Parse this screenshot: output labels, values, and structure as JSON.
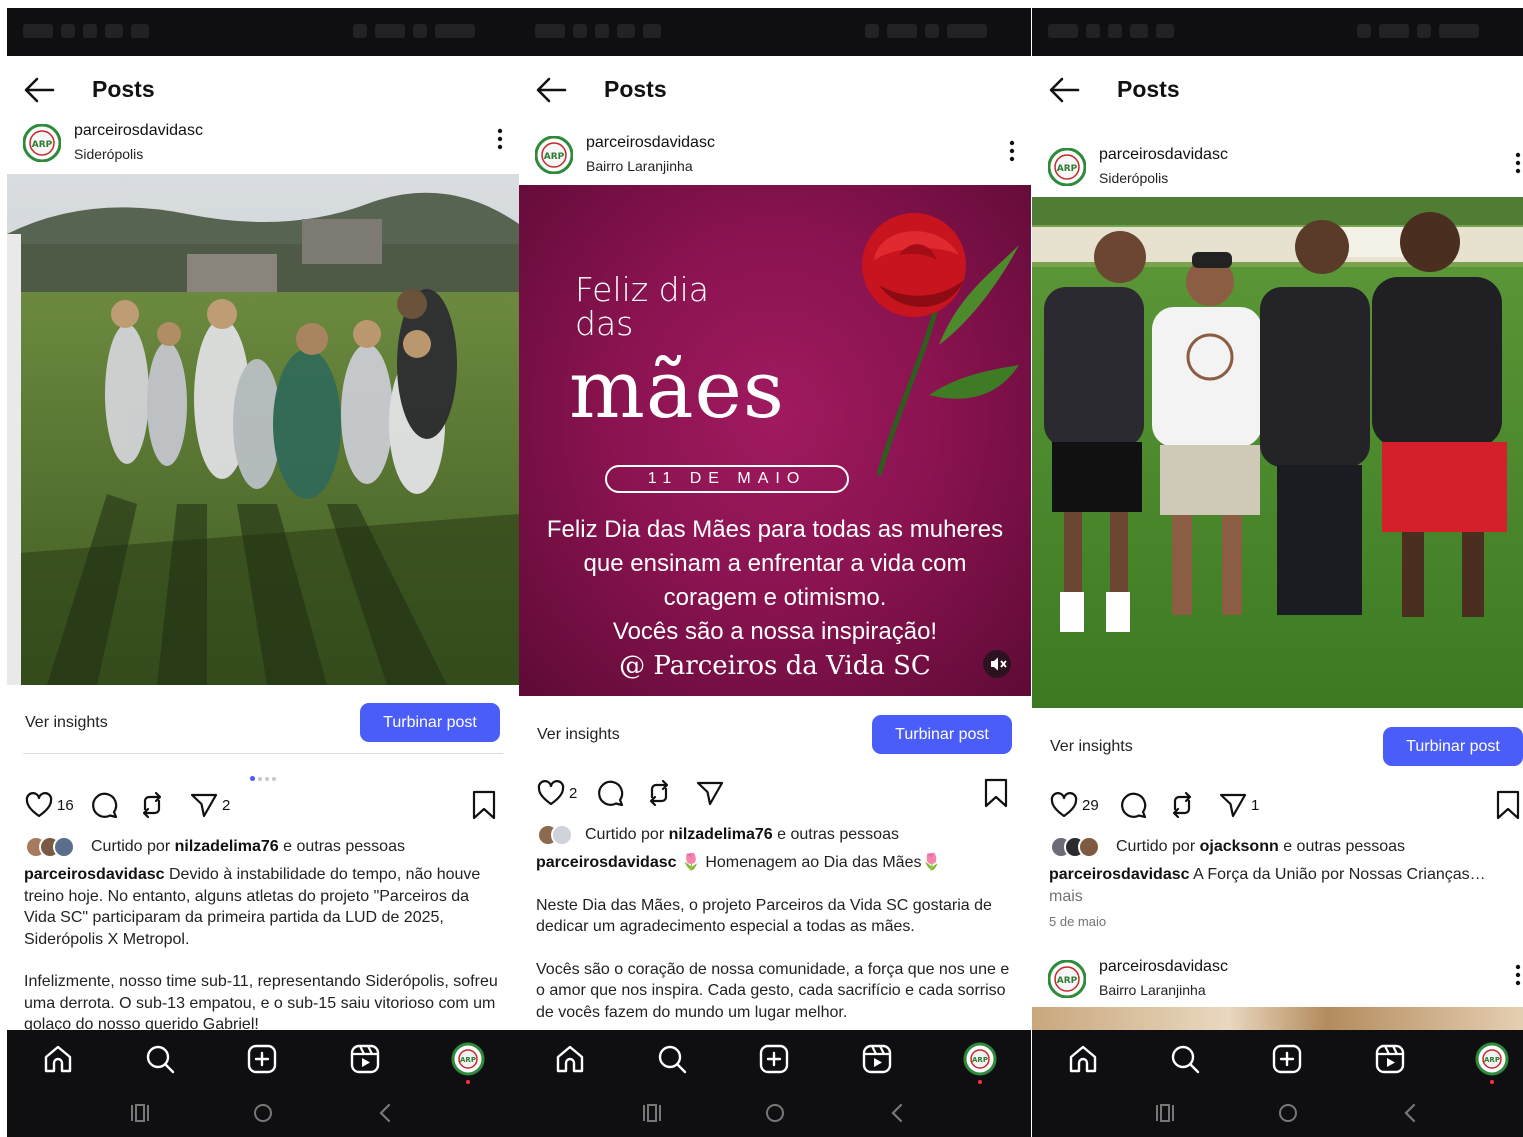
{
  "screens": [
    {
      "header": {
        "title": "Posts"
      },
      "post": {
        "username": "parceirosdavidasc",
        "location": "Siderópolis",
        "insights_label": "Ver insights",
        "boost_label": "Turbinar post",
        "likes": "16",
        "shares": "2",
        "liked_prefix": "Curtido por",
        "liked_user": "nilzadelima76",
        "liked_suffix": "e outras pessoas",
        "caption_user": "parceirosdavidasc",
        "caption_p1": "Devido à instabilidade do tempo, não houve treino hoje. No entanto, alguns atletas do projeto \"Parceiros da Vida SC\" participaram da primeira partida da LUD de 2025, Siderópolis X Metropol.",
        "caption_p2": "Infelizmente, nosso time sub-11, representando Siderópolis, sofreu uma derrota. O sub-13 empatou, e o sub-15 saiu vitorioso com um golaço do nosso querido Gabriel!",
        "carousel_index": 1,
        "carousel_total": 4
      }
    },
    {
      "header": {
        "title": "Posts"
      },
      "post": {
        "username": "parceirosdavidasc",
        "location": "Bairro Laranjinha",
        "insights_label": "Ver insights",
        "boost_label": "Turbinar post",
        "likes": "2",
        "liked_prefix": "Curtido por",
        "liked_user": "nilzadelima76",
        "liked_suffix": "e outras pessoas",
        "caption_user": "parceirosdavidasc",
        "caption_title": "🌷 Homenagem ao Dia das Mães🌷",
        "caption_p1": "Neste Dia das Mães, o projeto Parceiros da Vida SC gostaria de dedicar um agradecimento especial a todas as mães.",
        "caption_p2": "Vocês são o coração de nossa comunidade, a força que nos une e o amor que nos inspira. Cada gesto, cada sacrifício e cada sorriso de vocês fazem do mundo um lugar melhor.",
        "image": {
          "line1": "Feliz dia",
          "line2": "das",
          "big": "mães",
          "date": "11 DE MAIO",
          "msg1": "Feliz Dia das Mães para todas as muheres",
          "msg2": "que ensinam a enfrentar a vida com",
          "msg3": "coragem e otimismo.",
          "msg4": "Vocês são a nossa inspiração!",
          "signature": "@ Parceiros da Vida SC"
        }
      }
    },
    {
      "header": {
        "title": "Posts"
      },
      "post": {
        "username": "parceirosdavidasc",
        "location": "Siderópolis",
        "insights_label": "Ver insights",
        "boost_label": "Turbinar post",
        "likes": "29",
        "shares": "1",
        "liked_prefix": "Curtido por",
        "liked_user": "ojacksonn",
        "liked_suffix": "e outras pessoas",
        "caption_user": "parceirosdavidasc",
        "caption_p1": "A Força da União por Nossas Crianças…",
        "more": "mais",
        "date": "5 de maio"
      },
      "next_post": {
        "username": "parceirosdavidasc",
        "location": "Bairro Laranjinha"
      }
    }
  ],
  "colors": {
    "accent": "#4a5df9",
    "nav_bg": "#0f0f12",
    "mothers_bg": "#8a1350",
    "notification_dot": "#ff3040"
  },
  "icons": [
    "back-arrow-icon",
    "kebab-icon",
    "heart-icon",
    "comment-icon",
    "repost-icon",
    "share-icon",
    "bookmark-icon",
    "home-icon",
    "search-icon",
    "create-icon",
    "reels-icon",
    "profile-icon",
    "recents-icon",
    "home-circle-icon",
    "back-chevron-icon",
    "mute-icon"
  ]
}
